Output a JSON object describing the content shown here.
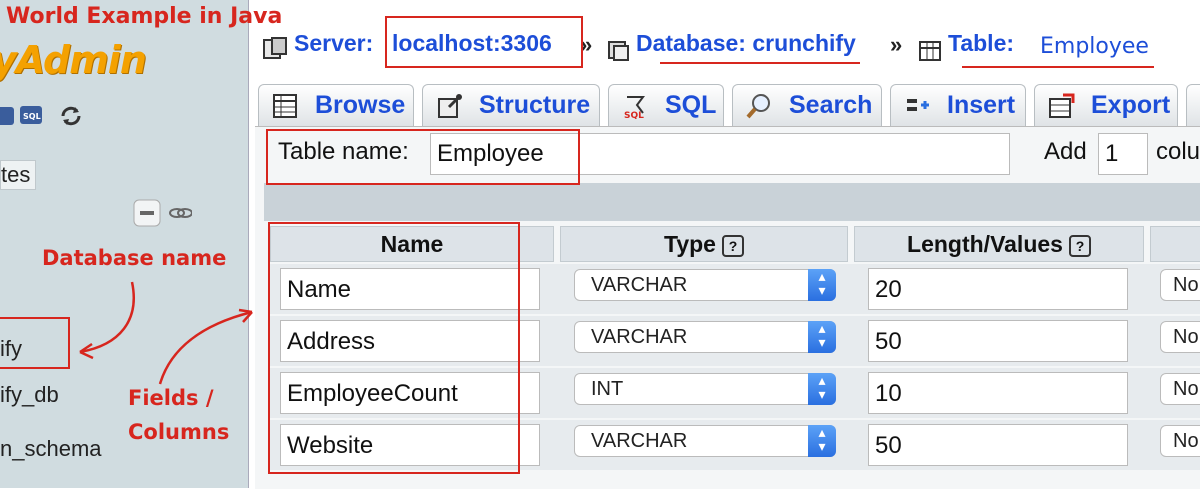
{
  "banner": {
    "text": "World Example in Java"
  },
  "sidebar": {
    "logo_text": "yAdmin",
    "tab_label": "tes",
    "databases": [
      "ify",
      "ify_db",
      "n_schema"
    ]
  },
  "breadcrumb": {
    "server_label": "Server:",
    "server_value": "localhost:3306",
    "database_label": "Database: crunchify",
    "table_label": "Table:",
    "table_value": "Employee",
    "separator": "»"
  },
  "tabs": [
    {
      "label": "Browse",
      "icon": "browse-icon"
    },
    {
      "label": "Structure",
      "icon": "structure-icon"
    },
    {
      "label": "SQL",
      "icon": "sql-icon"
    },
    {
      "label": "Search",
      "icon": "search-icon"
    },
    {
      "label": "Insert",
      "icon": "insert-icon"
    },
    {
      "label": "Export",
      "icon": "export-icon"
    }
  ],
  "form": {
    "table_name_label": "Table name:",
    "table_name_value": "Employee",
    "add_label": "Add",
    "add_value": "1",
    "add_suffix": "colu"
  },
  "columns_table": {
    "headers": {
      "name": "Name",
      "type": "Type",
      "length": "Length/Values",
      "help": "?"
    },
    "rows": [
      {
        "name": "Name",
        "type": "VARCHAR",
        "length": "20",
        "default": "No"
      },
      {
        "name": "Address",
        "type": "VARCHAR",
        "length": "50",
        "default": "No"
      },
      {
        "name": "EmployeeCount",
        "type": "INT",
        "length": "10",
        "default": "No"
      },
      {
        "name": "Website",
        "type": "VARCHAR",
        "length": "50",
        "default": "No"
      }
    ]
  },
  "annotations": {
    "database_name": "Database name",
    "fields_line1": "Fields /",
    "fields_line2": "Columns"
  },
  "colors": {
    "accent": "#1d4ed8",
    "annotation": "#d7261e",
    "logo": "#f4a100"
  }
}
